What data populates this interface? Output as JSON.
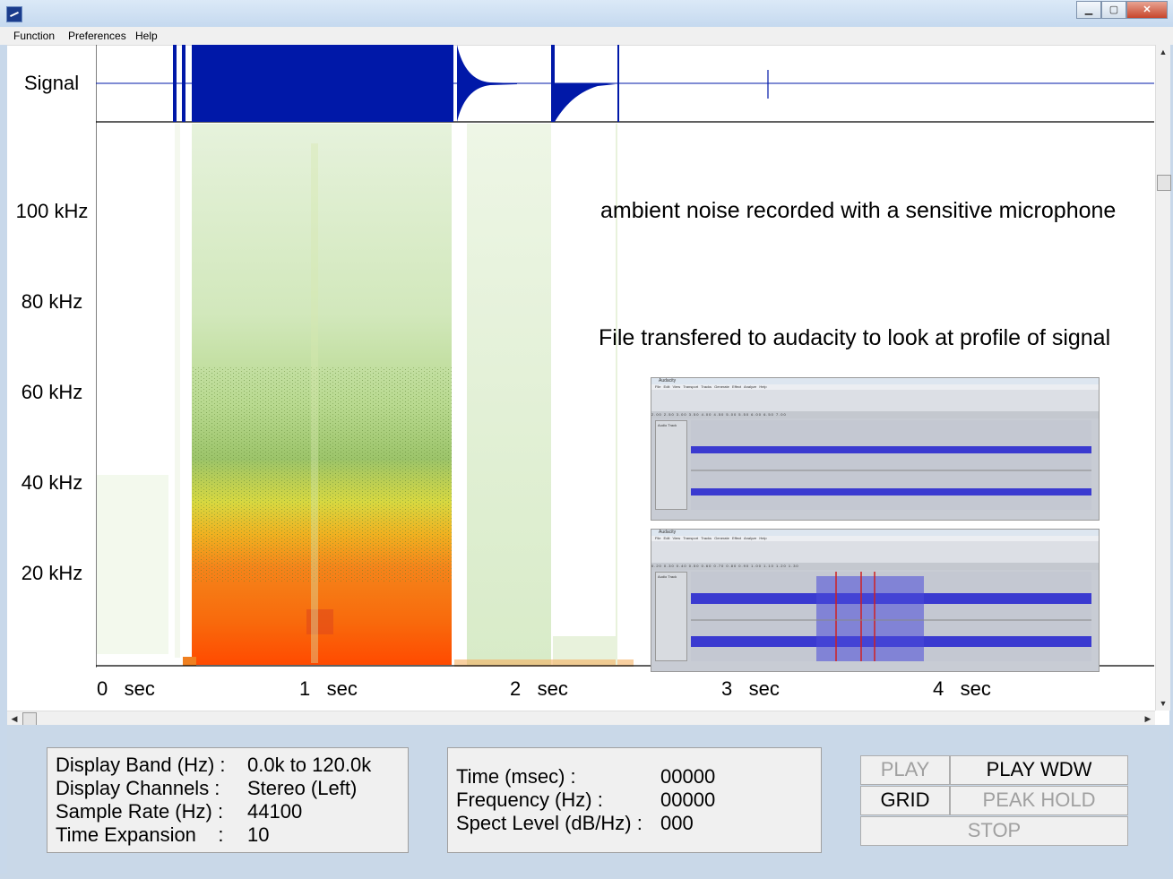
{
  "window": {
    "title": "",
    "buttons": {
      "minimize": "▁",
      "maximize": "▢",
      "close": "✕"
    }
  },
  "menu": [
    "Function",
    "Preferences",
    "Help"
  ],
  "labels": {
    "signal": "Signal",
    "frequencies": [
      "100 kHz",
      "80 kHz",
      "60 kHz",
      "40 kHz",
      "20 kHz"
    ],
    "times": [
      {
        "value": "0",
        "unit": "sec"
      },
      {
        "value": "1",
        "unit": "sec"
      },
      {
        "value": "2",
        "unit": "sec"
      },
      {
        "value": "3",
        "unit": "sec"
      },
      {
        "value": "4",
        "unit": "sec"
      }
    ]
  },
  "annotations": {
    "line1": "ambient noise recorded with a sensitive microphone",
    "line2": "File transfered to audacity to look at profile of signal"
  },
  "audacity": {
    "title": "Audacity",
    "menu": "File Edit View Transport Tracks Generate Effect Analyze Help",
    "track": "Audio Track",
    "ruler1": "2.00 2.50 3.00 3.50 4.00 4.50 5.00 5.50 6.00 6.50 7.00",
    "ruler2": "0.20 0.30 0.40 0.50 0.60 0.70 0.80 0.90 1.00 1.10 1.20 1.30"
  },
  "info_left": [
    {
      "label": "Display Band (Hz) :",
      "value": "0.0k to 120.0k"
    },
    {
      "label": "Display Channels :",
      "value": "Stereo (Left)"
    },
    {
      "label": "Sample Rate (Hz) :",
      "value": "44100"
    },
    {
      "label": "Time Expansion    :",
      "value": "10"
    }
  ],
  "info_right": [
    {
      "label": "Time (msec) :",
      "value": "00000"
    },
    {
      "label": "Frequency (Hz) :",
      "value": "00000"
    },
    {
      "label": "Spect Level (dB/Hz) :",
      "value": "000"
    }
  ],
  "controls": {
    "play": "PLAY",
    "play_wdw": "PLAY WDW",
    "grid": "GRID",
    "peak_hold": "PEAK HOLD",
    "stop": "STOP"
  },
  "colors": {
    "signal": "#0018a8",
    "spectrum_high": "#ff4a00",
    "spectrum_mid": "#e8e030",
    "spectrum_low": "#cfe6b8",
    "panel_bg": "#c9d8e8",
    "wave": "#4a4ad8"
  }
}
